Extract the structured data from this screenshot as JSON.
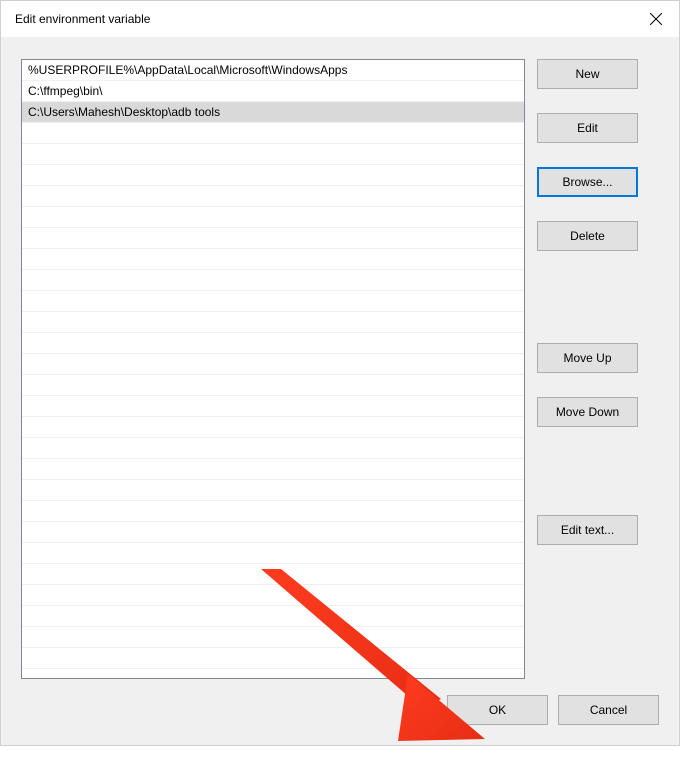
{
  "window": {
    "title": "Edit environment variable"
  },
  "path_list": {
    "items": [
      "%USERPROFILE%\\AppData\\Local\\Microsoft\\WindowsApps",
      "C:\\ffmpeg\\bin\\",
      "C:\\Users\\Mahesh\\Desktop\\adb tools"
    ],
    "selected_index": 2
  },
  "buttons": {
    "new": "New",
    "edit": "Edit",
    "browse": "Browse...",
    "delete": "Delete",
    "move_up": "Move Up",
    "move_down": "Move Down",
    "edit_text": "Edit text...",
    "ok": "OK",
    "cancel": "Cancel"
  },
  "annotation": {
    "arrow_color": "#ff3b1f"
  }
}
